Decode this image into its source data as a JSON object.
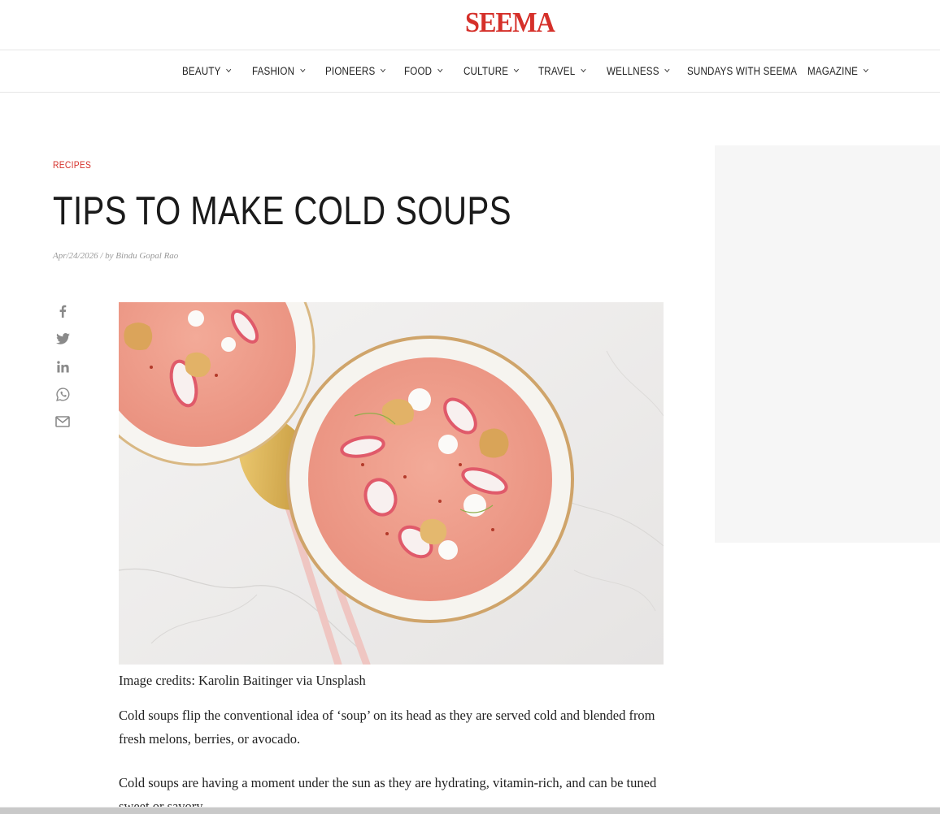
{
  "site": {
    "logo": "SEEMA"
  },
  "nav": {
    "items": [
      {
        "label": "BEAUTY",
        "dropdown": true
      },
      {
        "label": "FASHION",
        "dropdown": true
      },
      {
        "label": "PIONEERS",
        "dropdown": true
      },
      {
        "label": "FOOD",
        "dropdown": true
      },
      {
        "label": "CULTURE",
        "dropdown": true
      },
      {
        "label": "TRAVEL",
        "dropdown": true
      },
      {
        "label": "WELLNESS",
        "dropdown": true
      },
      {
        "label": "SUNDAYS WITH SEEMA",
        "dropdown": false
      },
      {
        "label": "MAGAZINE",
        "dropdown": true
      }
    ]
  },
  "article": {
    "category": "RECIPES",
    "title": "TIPS TO MAKE COLD SOUPS",
    "meta": "Apr/24/2026 / by Bindu Gopal Rao",
    "image_caption": "Image credits: Karolin Baitinger via Unsplash",
    "paragraphs": [
      "Cold soups flip the conventional idea of ‘soup’ on its head as they are served cold and blended from fresh melons, berries, or avocado.",
      "Cold soups are having a moment under the sun as they are hydrating, vitamin-rich, and can be tuned sweet or savory."
    ]
  },
  "share": {
    "icons": [
      "facebook-icon",
      "twitter-icon",
      "linkedin-icon",
      "whatsapp-icon",
      "email-icon"
    ]
  },
  "colors": {
    "brand": "#d5302a",
    "text": "#222222",
    "meta": "#999999",
    "icon": "#8a8a8a",
    "sidebar_bg": "#f6f6f6"
  }
}
